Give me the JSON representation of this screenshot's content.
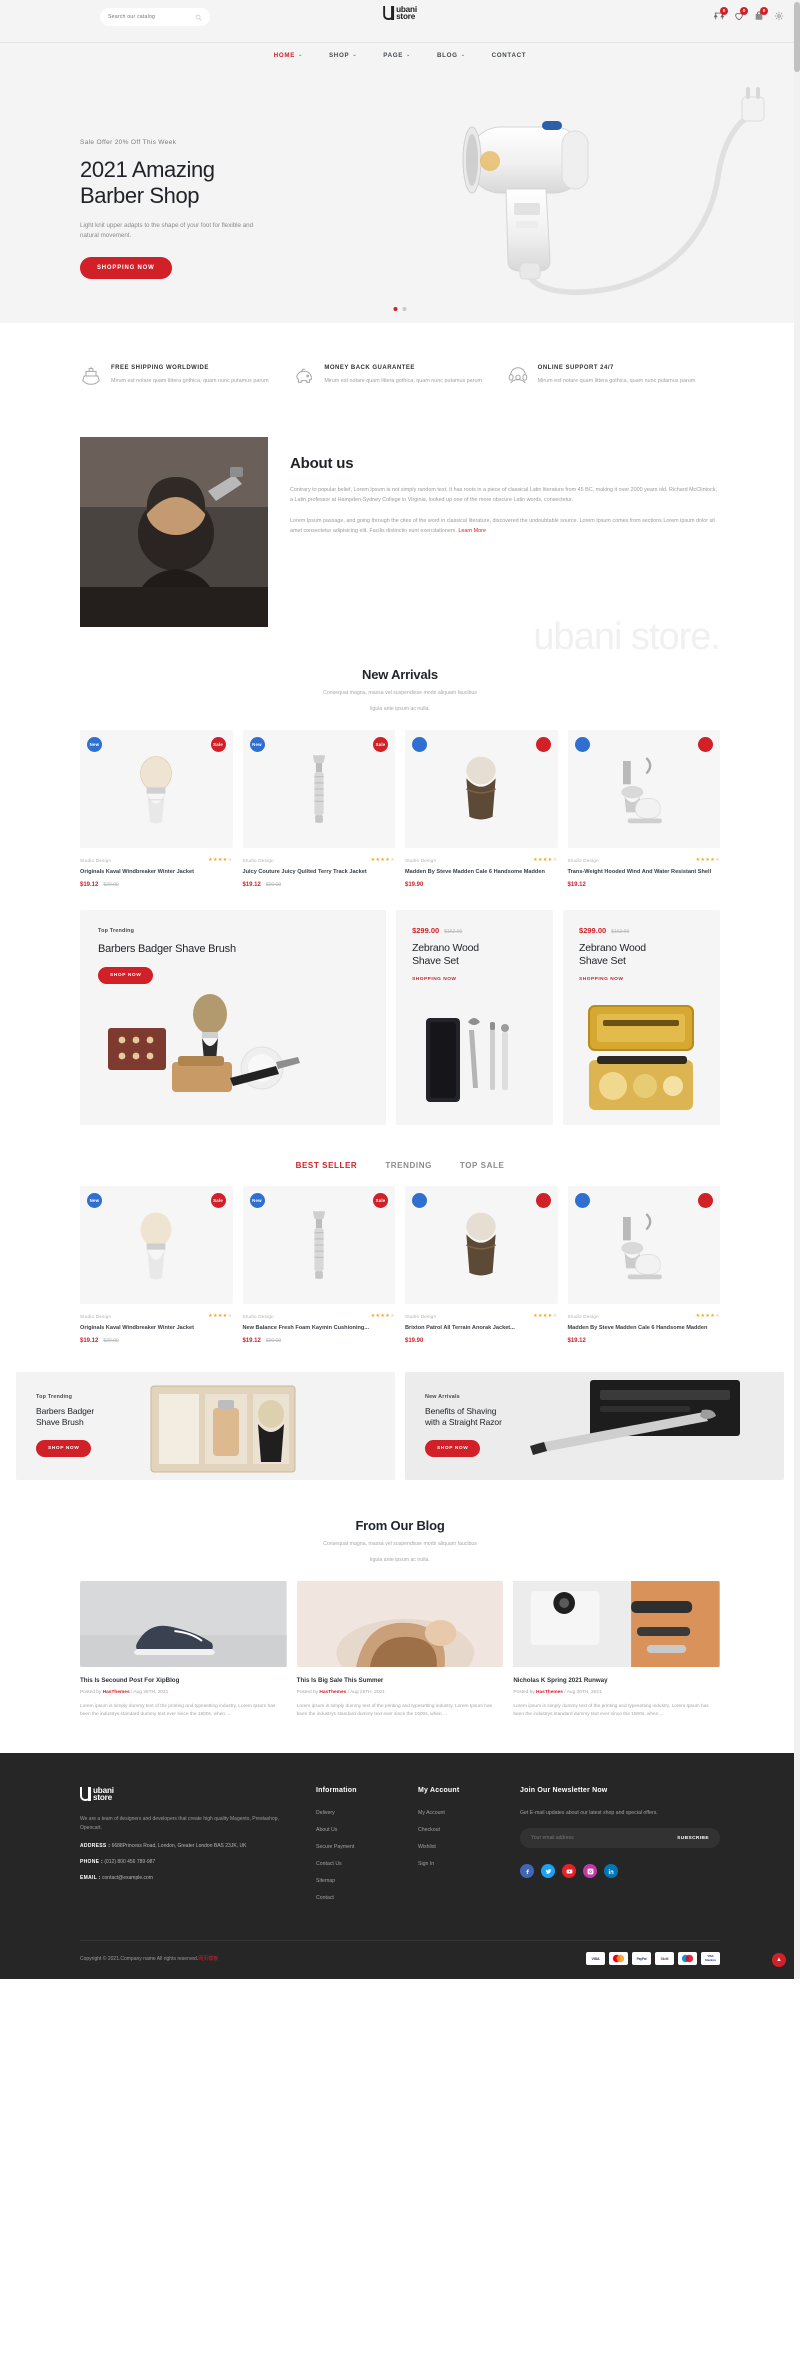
{
  "brand": {
    "name_line1": "ubani",
    "name_line2": "store"
  },
  "colors": {
    "accent": "#d12027",
    "dark": "#262626",
    "light_bg": "#f4f4f4"
  },
  "topbar": {
    "search_placeholder": "Search our catalog",
    "search_value": "",
    "icons": [
      {
        "name": "compare-icon",
        "badge": "0"
      },
      {
        "name": "wishlist-icon",
        "badge": "0"
      },
      {
        "name": "cart-icon",
        "badge": "0"
      },
      {
        "name": "settings-icon",
        "badge": ""
      }
    ]
  },
  "nav": {
    "items": [
      {
        "label": "HOME",
        "caret": "⌄",
        "active": true
      },
      {
        "label": "SHOP",
        "caret": "⌄",
        "active": false
      },
      {
        "label": "PAGE",
        "caret": "⌄",
        "active": false
      },
      {
        "label": "BLOG",
        "caret": "⌄",
        "active": false
      },
      {
        "label": "CONTACT",
        "caret": "",
        "active": false
      }
    ]
  },
  "hero": {
    "kicker": "Sale Offer 20% Off This Week",
    "title_line1": "2021 Amazing",
    "title_line2": "Barber Shop",
    "subtitle": "Light knit upper adapts to the shape of your foot for flexible and natural movement.",
    "cta": "SHOPPING NOW",
    "slide_count": 2,
    "active_slide": 1
  },
  "features": [
    {
      "icon": "ship-icon",
      "title": "FREE SHIPPING WORLDWIDE",
      "text": "Mirum est notare quam littera gothica, quam nunc putamus parum"
    },
    {
      "icon": "piggy-bank-icon",
      "title": "MONEY BACK GUARANTEE",
      "text": "Mirum est notare quam littera gothica, quam nunc putamus parum"
    },
    {
      "icon": "headset-icon",
      "title": "ONLINE SUPPORT 24/7",
      "text": "Mirum est notare quam littera gothica, quam nunc putamus parum"
    }
  ],
  "about": {
    "heading": "About us",
    "p1": "Contrary to popular belief, Lorem Ipsum is not simply random text. It has roots in a piece of classical Latin literature from 45 BC, making it over 2000 years old. Richard McClintock, a Latin professor at Hampden-Sydney College in Virginia, looked up one of the more obscure Latin words, consectetur.",
    "p2": "Lorem Ipsum passage, and going through the cites of the word in classical literature, discovered the undoubtable source. Lorem Ipsum comes from sections Lorem ipsum dolor sit amet consectetur adipisicing elit. Facilis distinctio sunt exercitationem.",
    "link": "Learn More",
    "ghost_text": "ubani store."
  },
  "new_arrivals": {
    "heading": "New Arrivals",
    "sub_line1": "Consequat magna, massa vel suspendisse morbi aliquam faucibus",
    "sub_line2": "ligula ante ipsum ac nulla.",
    "products": [
      {
        "brand": "Studio Design",
        "title": "Originals Kaval Windbreaker Winter Jacket",
        "price": "$19.12",
        "old_price": "$20.00",
        "rating": 4,
        "tag_new": "New",
        "tag_sale": "Sale",
        "image": "shave-brush"
      },
      {
        "brand": "Studio Design",
        "title": "Juicy Couture Juicy Quilted Terry Track Jacket",
        "price": "$19.12",
        "old_price": "$20.00",
        "rating": 4,
        "tag_new": "New",
        "tag_sale": "Sale",
        "image": "safety-razor"
      },
      {
        "brand": "Studio Design",
        "title": "Madden By Steve Madden Cale 6 Handsome Madden",
        "price": "$19.90",
        "old_price": "",
        "rating": 4,
        "tag_new": "",
        "tag_sale": "",
        "image": "horn-brush"
      },
      {
        "brand": "Studio Design",
        "title": "Trans-Weight Hooded Wind And Water Resistant Shell",
        "price": "$19.12",
        "old_price": "",
        "rating": 4,
        "tag_new": "",
        "tag_sale": "",
        "image": "shave-stand"
      }
    ]
  },
  "promos": [
    {
      "kicker": "Top Trending",
      "title": "Barbers Badger Shave Brush",
      "cta": "SHOP NOW",
      "price": "",
      "old_price": "",
      "type": "big",
      "image": "grooming-kit"
    },
    {
      "kicker": "",
      "title_line1": "Zebrano Wood",
      "title_line2": "Shave Set",
      "cta": "SHOPPING NOW",
      "price": "$299.00",
      "old_price": "$162.00",
      "type": "small",
      "image": "razor-case"
    },
    {
      "kicker": "",
      "title_line1": "Zebrano Wood",
      "title_line2": "Shave Set",
      "cta": "SHOPPING NOW",
      "price": "$299.00",
      "old_price": "$162.00",
      "type": "small",
      "image": "beard-kit"
    }
  ],
  "tabs": [
    {
      "label": "BEST SELLER",
      "active": true
    },
    {
      "label": "TRENDING",
      "active": false
    },
    {
      "label": "TOP SALE",
      "active": false
    }
  ],
  "best_seller": {
    "products": [
      {
        "brand": "Studio Design",
        "title": "Originals Kaval Windbreaker Winter Jacket",
        "price": "$19.12",
        "old_price": "$20.00",
        "rating": 4,
        "tag_new": "New",
        "tag_sale": "Sale",
        "image": "shave-brush"
      },
      {
        "brand": "Studio Design",
        "title": "New Balance Fresh Foam Kaymin Cushioning...",
        "price": "$19.12",
        "old_price": "$20.00",
        "rating": 4,
        "tag_new": "New",
        "tag_sale": "Sale",
        "image": "safety-razor"
      },
      {
        "brand": "Studio Design",
        "title": "Brixton Patrol All Terrain Anorak Jacket...",
        "price": "$19.90",
        "old_price": "",
        "rating": 4,
        "tag_new": "",
        "tag_sale": "",
        "image": "horn-brush"
      },
      {
        "brand": "Studio Design",
        "title": "Madden By Steve Madden Cale 6 Handsome Madden",
        "price": "$19.12",
        "old_price": "",
        "rating": 4,
        "tag_new": "",
        "tag_sale": "",
        "image": "shave-stand"
      }
    ]
  },
  "wide_banners": [
    {
      "kicker": "Top Trending",
      "title_line1": "Barbers Badger",
      "title_line2": "Shave Brush",
      "cta": "SHOP NOW",
      "image": "gift-box"
    },
    {
      "kicker": "New Arrivals",
      "title_line1": "Benefits of Shaving",
      "title_line2": "with a Straight Razor",
      "cta": "SHOP NOW",
      "image": "straight-razor"
    }
  ],
  "blog": {
    "heading": "From Our Blog",
    "sub_line1": "Consequat magna, massa vel suspendisse morbi aliquam faucibus",
    "sub_line2": "ligula ante ipsum ac nulla.",
    "posts": [
      {
        "title": "This Is Secound Post For XipBlog",
        "posted_by_label": "Posted by",
        "author": "HasThemes",
        "date": "Aug 26TH, 2021",
        "excerpt": "Lorem ipsum is simply dummy text of the printing and typesetting industry. Lorem Ipsum has been the industrys standard dummy text ever since the 1500s, when ...",
        "image": "sneakers"
      },
      {
        "title": "This Is Big Sale This Summer",
        "posted_by_label": "Posted by",
        "author": "HasThemes",
        "date": "Aug 26TH, 2021",
        "excerpt": "Lorem ipsum is simply dummy text of the printing and typesetting industry. Lorem Ipsum has been the industrys standard dummy text ever since the 1500s, when ...",
        "image": "woman-hair"
      },
      {
        "title": "Nicholas K Spring 2021 Runway",
        "posted_by_label": "Posted by",
        "author": "HasThemes",
        "date": "Aug 26TH, 2021",
        "excerpt": "Lorem ipsum is simply dummy text of the printing and typesetting industry. Lorem Ipsum has been the industrys standard dummy text ever since the 1500s, when ...",
        "image": "clipper-tools"
      }
    ]
  },
  "footer": {
    "about_text": "We are a team of designers and developers that create high quality Magento, Prestashop, Opencart.",
    "address_label": "ADDRESS :",
    "address_value": "6688Princess Road, London, Greater London BAS 23JK, UK",
    "phone_label": "PHONE :",
    "phone_value": "(012) 800 456 789-987",
    "email_label": "EMAIL :",
    "email_value": "contact@example.com",
    "information": {
      "heading": "Information",
      "links": [
        "Delivery",
        "About Us",
        "Secure Payment",
        "Contact Us",
        "Sitemap",
        "Contact"
      ]
    },
    "account": {
      "heading": "My Account",
      "links": [
        "My Account",
        "Checkout",
        "Wishlist",
        "Sign In"
      ]
    },
    "newsletter": {
      "heading": "Join Our Newsletter Now",
      "sub": "Get E-mail updates about our latest shop and special offers.",
      "placeholder": "Your email address",
      "value": "",
      "button": "SUBSCRIBE"
    },
    "socials": [
      {
        "name": "facebook-icon",
        "color": "#4267b2"
      },
      {
        "name": "twitter-icon",
        "color": "#1da1f2"
      },
      {
        "name": "youtube-icon",
        "color": "#e8202a"
      },
      {
        "name": "instagram-icon",
        "color": "#c13aa8"
      },
      {
        "name": "linkedin-icon",
        "color": "#0077b5"
      }
    ],
    "copyright_text": "Copyright © 2021.Company name All rights reserved.",
    "copyright_link": "网页模板",
    "payments": [
      "VISA",
      "MasterCard",
      "PayPal",
      "Skrill",
      "Maestro",
      "Electron"
    ]
  },
  "scroll_top": "▲"
}
